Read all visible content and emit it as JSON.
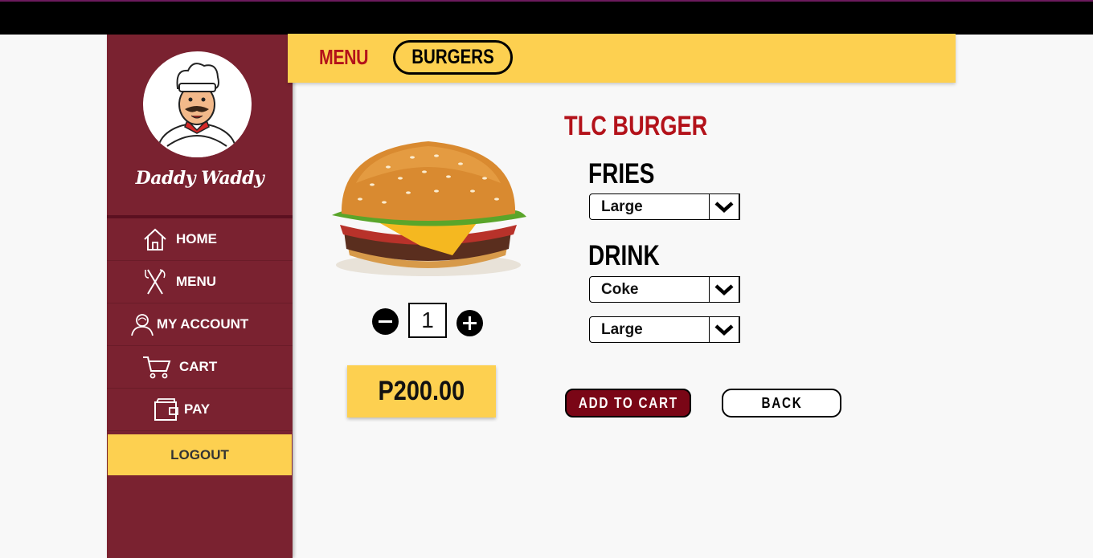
{
  "app": {
    "brand": "Daddy Waddy"
  },
  "sidebar": {
    "items": [
      {
        "label": "HOME",
        "icon": "home-icon"
      },
      {
        "label": "MENU",
        "icon": "fork-knife-icon"
      },
      {
        "label": "MY ACCOUNT",
        "icon": "user-icon"
      },
      {
        "label": "CART",
        "icon": "cart-icon"
      },
      {
        "label": "PAY",
        "icon": "wallet-icon"
      }
    ],
    "logout": "LOGOUT"
  },
  "header": {
    "crumb": "MENU",
    "category": "BURGERS"
  },
  "product": {
    "name": "TLC BURGER",
    "quantity": "1",
    "price": "P200.00",
    "fries_label": "FRIES",
    "fries_size": "Large",
    "drink_label": "DRINK",
    "drink_choice": "Coke",
    "drink_size": "Large"
  },
  "actions": {
    "add_to_cart": "ADD TO CART",
    "back": "BACK"
  },
  "colors": {
    "maroon": "#7a2230",
    "yellow": "#fdd050",
    "red_text": "#b3121a",
    "button_dark": "#7a0616"
  }
}
